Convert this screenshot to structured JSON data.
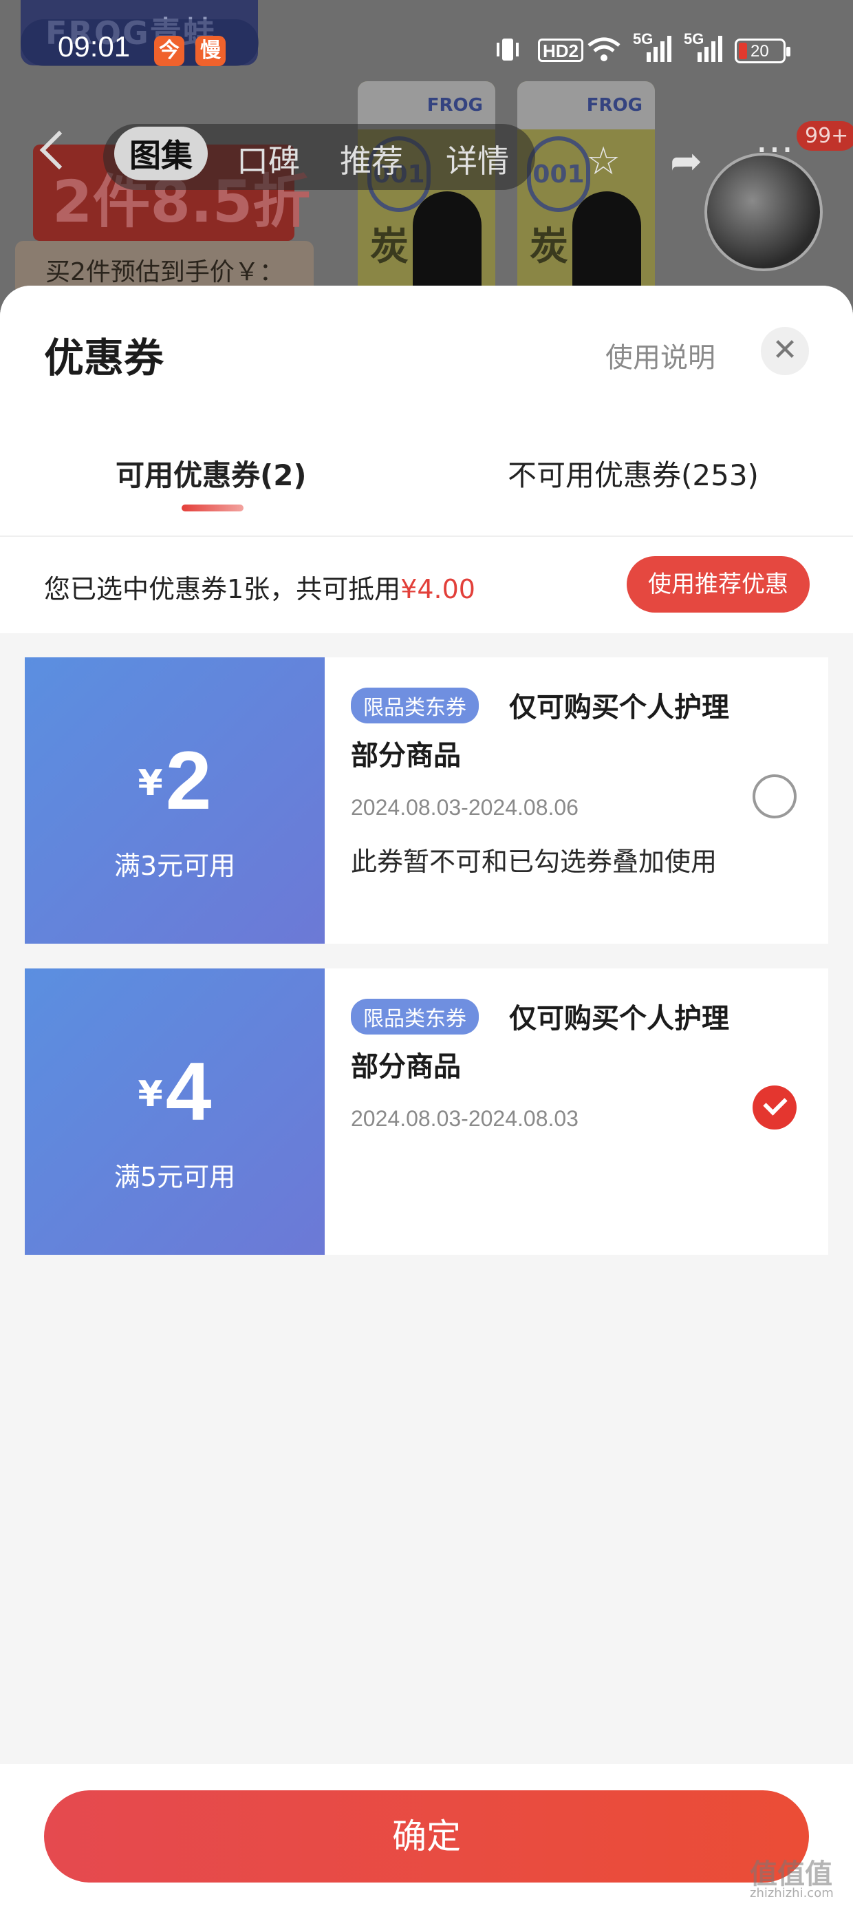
{
  "status_bar": {
    "time": "09:01",
    "app_icons": [
      "今",
      "慢"
    ],
    "signals": [
      "HD2",
      "5G",
      "5G"
    ],
    "battery": "20"
  },
  "background": {
    "brand": "FROG青蛙",
    "promo": "2件8.5折",
    "estimate": "买2件预估到手价￥：",
    "pack_brand": "FROG",
    "pack_char": "炭",
    "pack_num": "001",
    "cart_badge": "99+"
  },
  "nav": {
    "tabs": [
      "图集",
      "口碑",
      "推荐",
      "详情"
    ]
  },
  "sheet": {
    "title": "优惠券",
    "help": "使用说明",
    "close": "✕",
    "tabs": [
      "可用优惠券(2)",
      "不可用优惠券(253)"
    ],
    "summary_prefix": "您已选中优惠券1张，共可抵用",
    "summary_amount": "¥4.00",
    "recommend": "使用推荐优惠"
  },
  "coupons": [
    {
      "yen": "¥",
      "amount": "2",
      "condition": "满3元可用",
      "tag": "限品类东券",
      "name_line1": "仅可购买个人护理",
      "name_line2": "部分商品",
      "date": "2024.08.03-2024.08.06",
      "note": "此券暂不可和已勾选券叠加使用",
      "selected": false
    },
    {
      "yen": "¥",
      "amount": "4",
      "condition": "满5元可用",
      "tag": "限品类东券",
      "name_line1": "仅可购买个人护理",
      "name_line2": "部分商品",
      "date": "2024.08.03-2024.08.03",
      "note": "",
      "selected": true
    }
  ],
  "footer": {
    "confirm": "确定"
  },
  "watermark": {
    "text": "值值值",
    "url": "zhizhizhi.com"
  },
  "colors": {
    "accent_red": "#e4362f",
    "coupon_blue": "#6c79d6"
  }
}
